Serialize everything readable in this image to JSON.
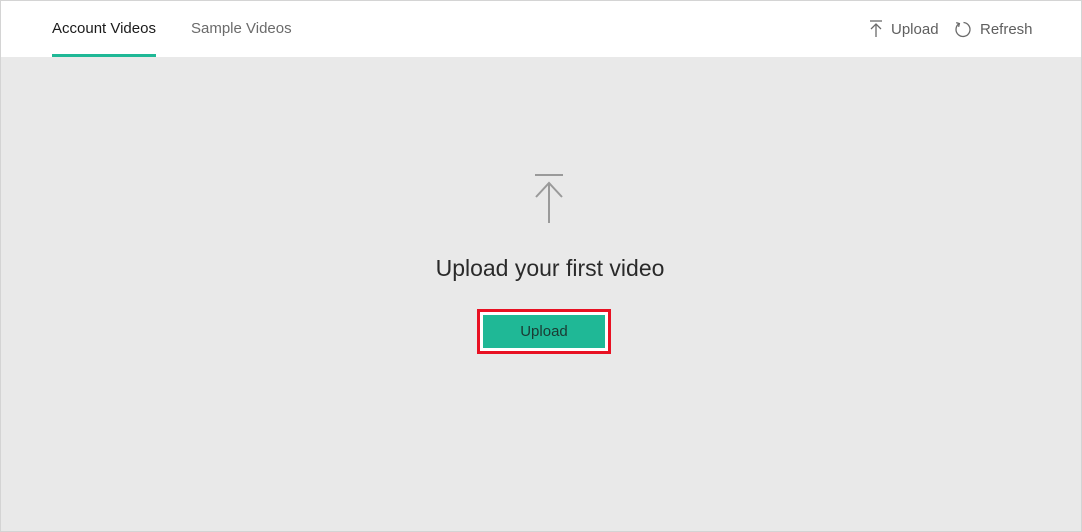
{
  "tabs": [
    {
      "label": "Account Videos",
      "active": true
    },
    {
      "label": "Sample Videos",
      "active": false
    }
  ],
  "toolbar": {
    "upload_label": "Upload",
    "upload_icon": "upload-icon",
    "refresh_label": "Refresh",
    "refresh_icon": "refresh-icon"
  },
  "empty_state": {
    "icon": "upload-icon",
    "title": "Upload your first video",
    "button_label": "Upload"
  },
  "colors": {
    "accent": "#1fb896",
    "highlight": "#e81123",
    "content_background": "#e9e9e9"
  }
}
